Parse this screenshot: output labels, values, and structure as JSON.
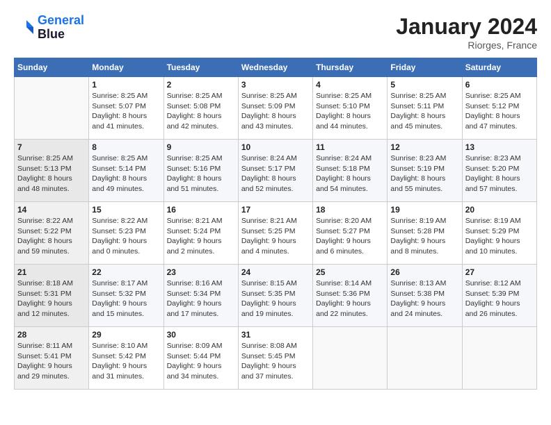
{
  "header": {
    "logo": {
      "line1": "General",
      "line2": "Blue"
    },
    "title": "January 2024",
    "location": "Riorges, France"
  },
  "columns": [
    "Sunday",
    "Monday",
    "Tuesday",
    "Wednesday",
    "Thursday",
    "Friday",
    "Saturday"
  ],
  "weeks": [
    [
      {
        "day": "",
        "sunrise": "",
        "sunset": "",
        "daylight": ""
      },
      {
        "day": "1",
        "sunrise": "Sunrise: 8:25 AM",
        "sunset": "Sunset: 5:07 PM",
        "daylight": "Daylight: 8 hours and 41 minutes."
      },
      {
        "day": "2",
        "sunrise": "Sunrise: 8:25 AM",
        "sunset": "Sunset: 5:08 PM",
        "daylight": "Daylight: 8 hours and 42 minutes."
      },
      {
        "day": "3",
        "sunrise": "Sunrise: 8:25 AM",
        "sunset": "Sunset: 5:09 PM",
        "daylight": "Daylight: 8 hours and 43 minutes."
      },
      {
        "day": "4",
        "sunrise": "Sunrise: 8:25 AM",
        "sunset": "Sunset: 5:10 PM",
        "daylight": "Daylight: 8 hours and 44 minutes."
      },
      {
        "day": "5",
        "sunrise": "Sunrise: 8:25 AM",
        "sunset": "Sunset: 5:11 PM",
        "daylight": "Daylight: 8 hours and 45 minutes."
      },
      {
        "day": "6",
        "sunrise": "Sunrise: 8:25 AM",
        "sunset": "Sunset: 5:12 PM",
        "daylight": "Daylight: 8 hours and 47 minutes."
      }
    ],
    [
      {
        "day": "7",
        "sunrise": "Sunrise: 8:25 AM",
        "sunset": "Sunset: 5:13 PM",
        "daylight": "Daylight: 8 hours and 48 minutes."
      },
      {
        "day": "8",
        "sunrise": "Sunrise: 8:25 AM",
        "sunset": "Sunset: 5:14 PM",
        "daylight": "Daylight: 8 hours and 49 minutes."
      },
      {
        "day": "9",
        "sunrise": "Sunrise: 8:25 AM",
        "sunset": "Sunset: 5:16 PM",
        "daylight": "Daylight: 8 hours and 51 minutes."
      },
      {
        "day": "10",
        "sunrise": "Sunrise: 8:24 AM",
        "sunset": "Sunset: 5:17 PM",
        "daylight": "Daylight: 8 hours and 52 minutes."
      },
      {
        "day": "11",
        "sunrise": "Sunrise: 8:24 AM",
        "sunset": "Sunset: 5:18 PM",
        "daylight": "Daylight: 8 hours and 54 minutes."
      },
      {
        "day": "12",
        "sunrise": "Sunrise: 8:23 AM",
        "sunset": "Sunset: 5:19 PM",
        "daylight": "Daylight: 8 hours and 55 minutes."
      },
      {
        "day": "13",
        "sunrise": "Sunrise: 8:23 AM",
        "sunset": "Sunset: 5:20 PM",
        "daylight": "Daylight: 8 hours and 57 minutes."
      }
    ],
    [
      {
        "day": "14",
        "sunrise": "Sunrise: 8:22 AM",
        "sunset": "Sunset: 5:22 PM",
        "daylight": "Daylight: 8 hours and 59 minutes."
      },
      {
        "day": "15",
        "sunrise": "Sunrise: 8:22 AM",
        "sunset": "Sunset: 5:23 PM",
        "daylight": "Daylight: 9 hours and 0 minutes."
      },
      {
        "day": "16",
        "sunrise": "Sunrise: 8:21 AM",
        "sunset": "Sunset: 5:24 PM",
        "daylight": "Daylight: 9 hours and 2 minutes."
      },
      {
        "day": "17",
        "sunrise": "Sunrise: 8:21 AM",
        "sunset": "Sunset: 5:25 PM",
        "daylight": "Daylight: 9 hours and 4 minutes."
      },
      {
        "day": "18",
        "sunrise": "Sunrise: 8:20 AM",
        "sunset": "Sunset: 5:27 PM",
        "daylight": "Daylight: 9 hours and 6 minutes."
      },
      {
        "day": "19",
        "sunrise": "Sunrise: 8:19 AM",
        "sunset": "Sunset: 5:28 PM",
        "daylight": "Daylight: 9 hours and 8 minutes."
      },
      {
        "day": "20",
        "sunrise": "Sunrise: 8:19 AM",
        "sunset": "Sunset: 5:29 PM",
        "daylight": "Daylight: 9 hours and 10 minutes."
      }
    ],
    [
      {
        "day": "21",
        "sunrise": "Sunrise: 8:18 AM",
        "sunset": "Sunset: 5:31 PM",
        "daylight": "Daylight: 9 hours and 12 minutes."
      },
      {
        "day": "22",
        "sunrise": "Sunrise: 8:17 AM",
        "sunset": "Sunset: 5:32 PM",
        "daylight": "Daylight: 9 hours and 15 minutes."
      },
      {
        "day": "23",
        "sunrise": "Sunrise: 8:16 AM",
        "sunset": "Sunset: 5:34 PM",
        "daylight": "Daylight: 9 hours and 17 minutes."
      },
      {
        "day": "24",
        "sunrise": "Sunrise: 8:15 AM",
        "sunset": "Sunset: 5:35 PM",
        "daylight": "Daylight: 9 hours and 19 minutes."
      },
      {
        "day": "25",
        "sunrise": "Sunrise: 8:14 AM",
        "sunset": "Sunset: 5:36 PM",
        "daylight": "Daylight: 9 hours and 22 minutes."
      },
      {
        "day": "26",
        "sunrise": "Sunrise: 8:13 AM",
        "sunset": "Sunset: 5:38 PM",
        "daylight": "Daylight: 9 hours and 24 minutes."
      },
      {
        "day": "27",
        "sunrise": "Sunrise: 8:12 AM",
        "sunset": "Sunset: 5:39 PM",
        "daylight": "Daylight: 9 hours and 26 minutes."
      }
    ],
    [
      {
        "day": "28",
        "sunrise": "Sunrise: 8:11 AM",
        "sunset": "Sunset: 5:41 PM",
        "daylight": "Daylight: 9 hours and 29 minutes."
      },
      {
        "day": "29",
        "sunrise": "Sunrise: 8:10 AM",
        "sunset": "Sunset: 5:42 PM",
        "daylight": "Daylight: 9 hours and 31 minutes."
      },
      {
        "day": "30",
        "sunrise": "Sunrise: 8:09 AM",
        "sunset": "Sunset: 5:44 PM",
        "daylight": "Daylight: 9 hours and 34 minutes."
      },
      {
        "day": "31",
        "sunrise": "Sunrise: 8:08 AM",
        "sunset": "Sunset: 5:45 PM",
        "daylight": "Daylight: 9 hours and 37 minutes."
      },
      {
        "day": "",
        "sunrise": "",
        "sunset": "",
        "daylight": ""
      },
      {
        "day": "",
        "sunrise": "",
        "sunset": "",
        "daylight": ""
      },
      {
        "day": "",
        "sunrise": "",
        "sunset": "",
        "daylight": ""
      }
    ]
  ]
}
